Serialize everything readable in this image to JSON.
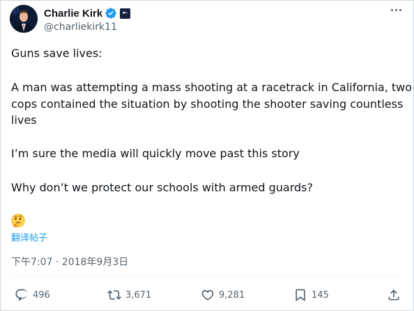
{
  "author": {
    "display_name": "Charlie Kirk",
    "handle": "@charliekirk11",
    "verified_color": "#1d9bf0"
  },
  "tweet": {
    "lines": [
      "Guns save lives:",
      "A man was attempting a mass shooting at a racetrack in California, two",
      "cops contained the situation by shooting the shooter saving countless",
      "lives",
      "I’m sure the media will quickly move past this story",
      "Why don’t we protect our schools with armed guards?"
    ],
    "emoji": "thinking-face",
    "translate_label": "翻译帖子",
    "timestamp": "下午7:07 · 2018年9月3日"
  },
  "stats": {
    "replies": "496",
    "reposts": "3,671",
    "likes": "9,281",
    "bookmarks": "145"
  },
  "colors": {
    "text": "#0f1419",
    "secondary": "#536471",
    "accent": "#1d9bf0"
  }
}
